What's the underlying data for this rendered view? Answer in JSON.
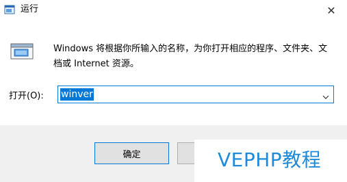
{
  "window": {
    "title": "运行",
    "close_symbol": "✕",
    "icon": "run-window-icon"
  },
  "dialog": {
    "icon": "run-dialog-icon",
    "description": "Windows 将根据你所输入的名称，为你打开相应的程序、文件夹、文档或 Internet 资源。",
    "open_label": "打开(O):",
    "open_value": "winver"
  },
  "buttons": {
    "ok_label": "确定"
  },
  "watermark": {
    "text": "VEPHP教程",
    "color": "#1f8ad8"
  },
  "colors": {
    "accent": "#0078d7",
    "footer_bg": "#f0f0f0"
  }
}
